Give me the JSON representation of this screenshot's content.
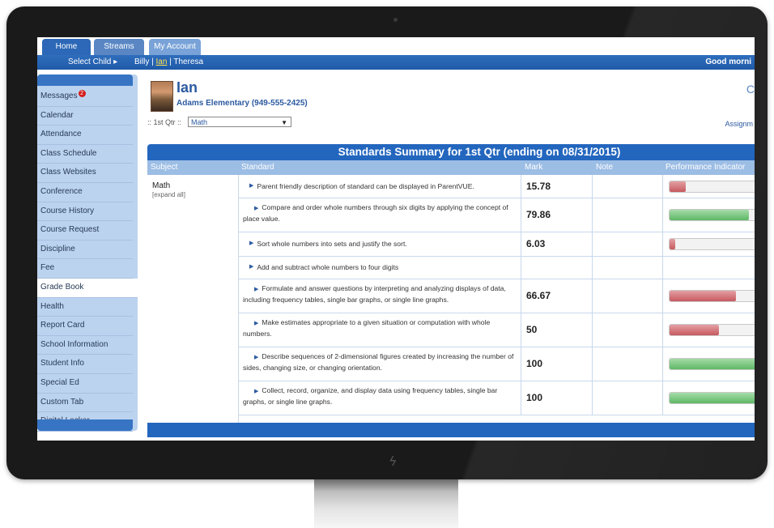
{
  "tabs": [
    {
      "label": "Home"
    },
    {
      "label": "Streams"
    },
    {
      "label": "My Account"
    }
  ],
  "child_bar": {
    "select_label": "Select Child ▸",
    "children": [
      "Billy",
      "Ian",
      "Theresa"
    ],
    "separator": " | ",
    "current_child": "Ian",
    "greeting": "Good morni"
  },
  "sidebar": {
    "items": [
      {
        "label": "Messages",
        "badge": "2"
      },
      {
        "label": "Calendar"
      },
      {
        "label": "Attendance"
      },
      {
        "label": "Class Schedule"
      },
      {
        "label": "Class Websites"
      },
      {
        "label": "Conference"
      },
      {
        "label": "Course History"
      },
      {
        "label": "Course Request"
      },
      {
        "label": "Discipline"
      },
      {
        "label": "Fee"
      },
      {
        "label": "Grade Book",
        "active": true
      },
      {
        "label": "Health"
      },
      {
        "label": "Report Card"
      },
      {
        "label": "School Information"
      },
      {
        "label": "Student Info"
      },
      {
        "label": "Special Ed"
      },
      {
        "label": "Custom Tab"
      },
      {
        "label": "Digital Locker"
      }
    ]
  },
  "student": {
    "name": "Ian",
    "school": "Adams Elementary (949-555-2425)",
    "quarter_label": ":: 1st Qtr ::",
    "subject_select": "Math",
    "assignments_link": "Assignm",
    "corner_glyph": "C"
  },
  "summary": {
    "title": "Standards Summary for 1st Qtr (ending on 08/31/2015)",
    "columns": [
      "Subject",
      "Standard",
      "Mark",
      "Note",
      "Performance Indicator"
    ],
    "subject": "Math",
    "expand_label": "[expand all]",
    "rows": [
      {
        "standard": "Parent friendly description of standard can be displayed in ParentVUE.",
        "mark": "15.78",
        "indicator": 0.16,
        "color": "red"
      },
      {
        "standard": "Compare and order whole numbers through six digits by applying the concept of place value.",
        "mark": "79.86",
        "indicator": 0.8,
        "color": "green"
      },
      {
        "standard": "Sort whole numbers into sets and justify the sort.",
        "mark": "6.03",
        "indicator": 0.06,
        "color": "red"
      },
      {
        "standard": "Add and subtract whole numbers to four digits",
        "mark": "",
        "indicator": null,
        "color": ""
      },
      {
        "standard": "Formulate and answer questions by interpreting and analyzing displays of data, including frequency tables, single bar graphs, or single line graphs.",
        "mark": "66.67",
        "indicator": 0.67,
        "color": "red"
      },
      {
        "standard": "Make estimates appropriate to a given situation or computation with whole numbers.",
        "mark": "50",
        "indicator": 0.5,
        "color": "red"
      },
      {
        "standard": "Describe sequences of 2-dimensional figures created by increasing the number of sides, changing size, or changing orientation.",
        "mark": "100",
        "indicator": 1.0,
        "color": "green"
      },
      {
        "standard": "Collect, record, organize, and display data using frequency tables, single bar graphs, or single line graphs.",
        "mark": "100",
        "indicator": 1.0,
        "color": "green"
      }
    ]
  },
  "colors": {
    "primary_blue": "#2366be",
    "bar_red": "#c75a60",
    "bar_green": "#5fb866",
    "badge_red": "#d21c1c"
  }
}
